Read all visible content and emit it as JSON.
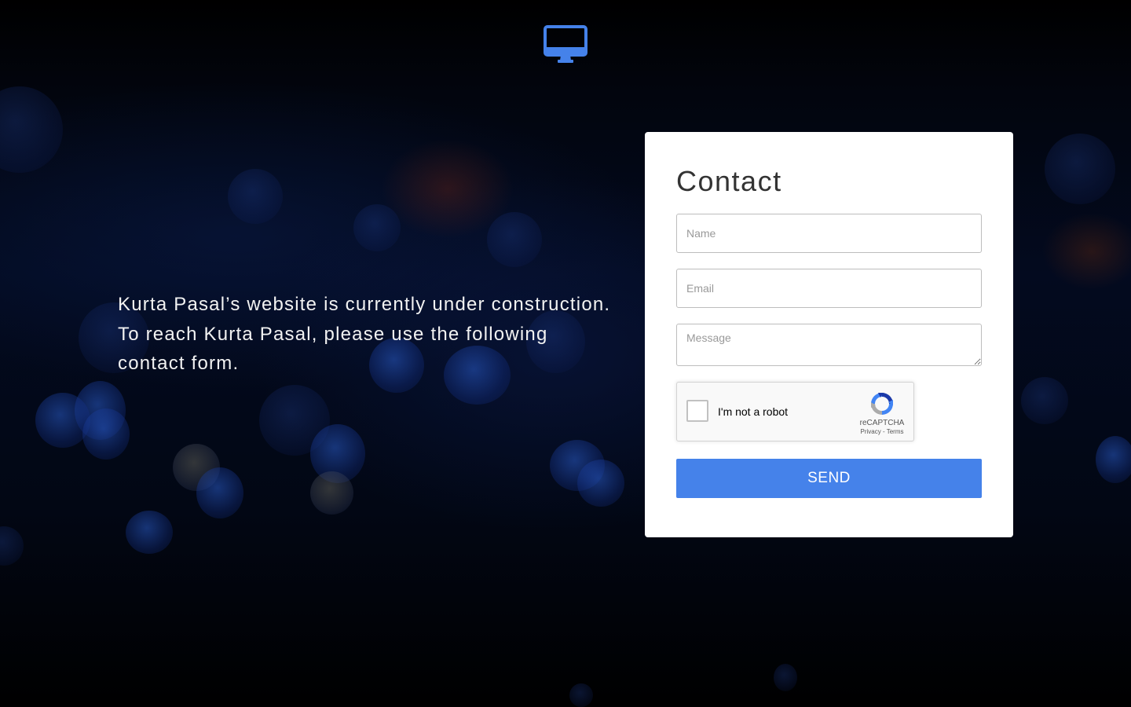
{
  "logo": {
    "icon": "monitor-icon",
    "color": "#4582ea"
  },
  "intro": {
    "text": "Kurta Pasal’s website is currently under construction. To reach Kurta Pasal, please use the following contact form."
  },
  "contact": {
    "title": "Contact",
    "name_placeholder": "Name",
    "email_placeholder": "Email",
    "message_placeholder": "Message",
    "captcha": {
      "label": "I'm not a robot",
      "brand": "reCAPTCHA",
      "privacy": "Privacy",
      "separator": " - ",
      "terms": "Terms"
    },
    "send_label": "SEND",
    "accent": "#4582ea"
  }
}
